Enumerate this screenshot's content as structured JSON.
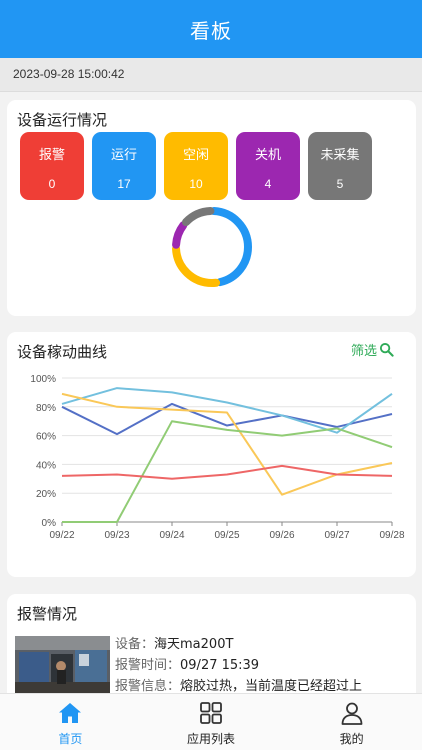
{
  "header": {
    "title": "看板"
  },
  "datetime": "2023-09-28 15:00:42",
  "status": {
    "title": "设备运行情况",
    "tiles": [
      {
        "label": "报警",
        "count": "0",
        "color": "#ef3e36"
      },
      {
        "label": "运行",
        "count": "17",
        "color": "#2196f3"
      },
      {
        "label": "空闲",
        "count": "10",
        "color": "#ffbb00"
      },
      {
        "label": "关机",
        "count": "4",
        "color": "#9c27b0"
      },
      {
        "label": "未采集",
        "count": "5",
        "color": "#777777"
      }
    ]
  },
  "chart": {
    "title": "设备稼动曲线",
    "filter_label": "筛选"
  },
  "chart_data": {
    "type": "line",
    "x": [
      "09/22",
      "09/23",
      "09/24",
      "09/25",
      "09/26",
      "09/27",
      "09/28"
    ],
    "ylim": [
      0,
      100
    ],
    "yticks": [
      "0%",
      "20%",
      "40%",
      "60%",
      "80%",
      "100%"
    ],
    "grid": true,
    "series": [
      {
        "color": "#5470c6",
        "values": [
          80,
          61,
          82,
          67,
          74,
          66,
          75
        ]
      },
      {
        "color": "#73c0de",
        "values": [
          82,
          93,
          90,
          83,
          74,
          62,
          89
        ]
      },
      {
        "color": "#fac858",
        "values": [
          89,
          80,
          78,
          76,
          19,
          33,
          41
        ]
      },
      {
        "color": "#91cc75",
        "values": [
          0,
          0,
          70,
          64,
          60,
          65,
          52
        ]
      },
      {
        "color": "#ee6666",
        "values": [
          32,
          33,
          30,
          33,
          39,
          33,
          32
        ]
      }
    ]
  },
  "alarm": {
    "title": "报警情况",
    "device_key": "设备：",
    "device_value": "海天ma200T",
    "time_key": "报警时间：",
    "time_value": "09/27 15:39",
    "info_key": "报警信息：",
    "info_value": "熔胶过热，当前温度已经超过上"
  },
  "nav": {
    "home": "首页",
    "apps": "应用列表",
    "mine": "我的",
    "active_color": "#2196f3"
  }
}
